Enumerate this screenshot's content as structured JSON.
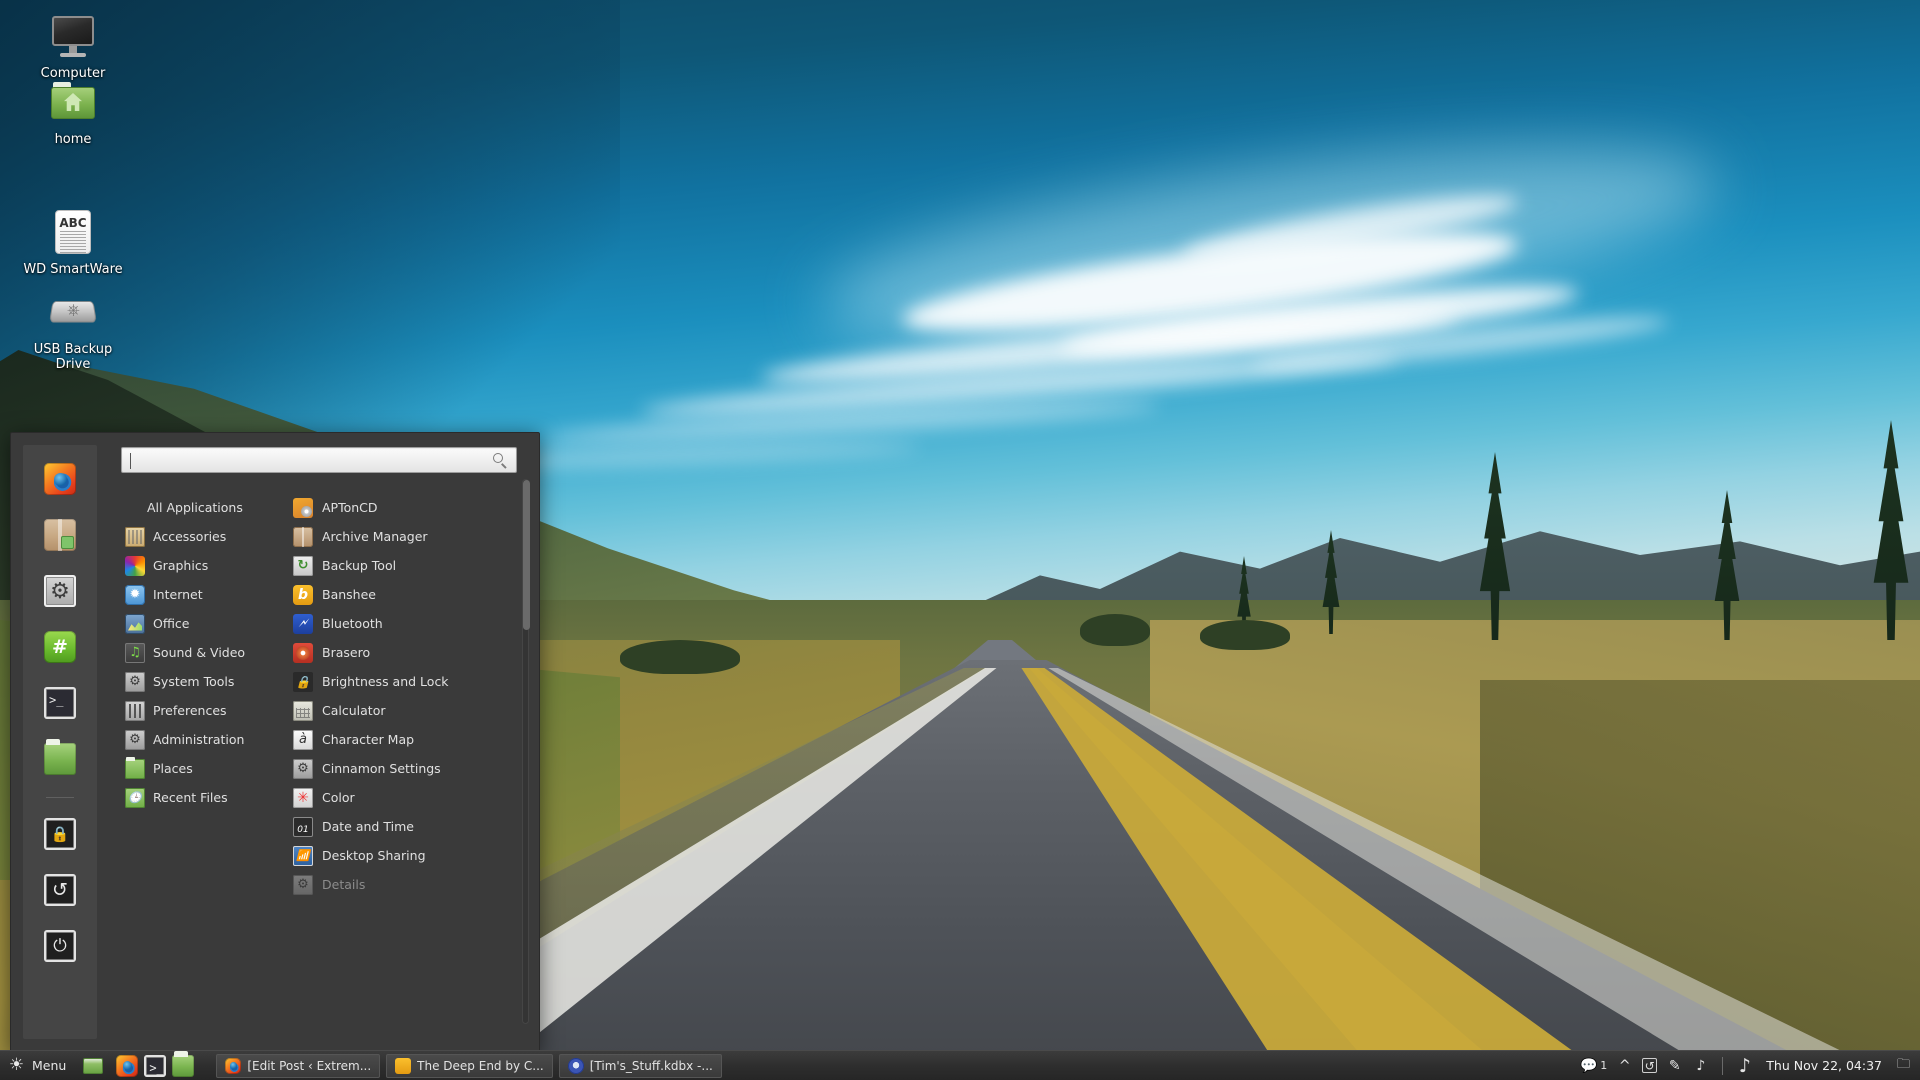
{
  "desktop": {
    "icons": [
      {
        "label": "Computer",
        "icon": "computer-monitor-icon"
      },
      {
        "label": "home",
        "icon": "home-folder-icon"
      },
      {
        "label": "WD SmartWare",
        "icon": "document-abc-icon"
      },
      {
        "label": "USB Backup Drive",
        "icon": "usb-drive-icon"
      }
    ]
  },
  "menu": {
    "search": {
      "value": "",
      "placeholder": ""
    },
    "favorites": [
      {
        "name": "firefox-web-browser",
        "icon": "firefox-icon"
      },
      {
        "name": "software-manager",
        "icon": "package-box-icon"
      },
      {
        "name": "system-settings",
        "icon": "gears-icon"
      },
      {
        "name": "chat-irc",
        "icon": "hash-chat-icon"
      },
      {
        "name": "terminal",
        "icon": "terminal-icon"
      },
      {
        "name": "files",
        "icon": "folder-icon"
      },
      {
        "name": "lock-screen",
        "icon": "lock-icon"
      },
      {
        "name": "log-out",
        "icon": "logout-icon"
      },
      {
        "name": "quit-shutdown",
        "icon": "power-icon"
      }
    ],
    "categories": [
      {
        "label": "All Applications",
        "icon": ""
      },
      {
        "label": "Accessories",
        "icon": "accessories-icon"
      },
      {
        "label": "Graphics",
        "icon": "graphics-icon"
      },
      {
        "label": "Internet",
        "icon": "internet-icon"
      },
      {
        "label": "Office",
        "icon": "office-icon"
      },
      {
        "label": "Sound & Video",
        "icon": "sound-video-icon"
      },
      {
        "label": "System Tools",
        "icon": "system-tools-icon"
      },
      {
        "label": "Preferences",
        "icon": "preferences-icon"
      },
      {
        "label": "Administration",
        "icon": "administration-icon"
      },
      {
        "label": "Places",
        "icon": "places-folder-icon"
      },
      {
        "label": "Recent Files",
        "icon": "recent-files-icon"
      }
    ],
    "applications": [
      {
        "label": "APTonCD",
        "icon": "aptoncd-icon",
        "dim": false
      },
      {
        "label": "Archive Manager",
        "icon": "archive-manager-icon",
        "dim": false
      },
      {
        "label": "Backup Tool",
        "icon": "backup-tool-icon",
        "dim": false
      },
      {
        "label": "Banshee",
        "icon": "banshee-icon",
        "dim": false
      },
      {
        "label": "Bluetooth",
        "icon": "bluetooth-icon",
        "dim": false
      },
      {
        "label": "Brasero",
        "icon": "brasero-icon",
        "dim": false
      },
      {
        "label": "Brightness and Lock",
        "icon": "brightness-lock-icon",
        "dim": false
      },
      {
        "label": "Calculator",
        "icon": "calculator-icon",
        "dim": false
      },
      {
        "label": "Character Map",
        "icon": "character-map-icon",
        "dim": false
      },
      {
        "label": "Cinnamon Settings",
        "icon": "cinnamon-settings-icon",
        "dim": false
      },
      {
        "label": "Color",
        "icon": "color-icon",
        "dim": false
      },
      {
        "label": "Date and Time",
        "icon": "date-time-icon",
        "dim": false
      },
      {
        "label": "Desktop Sharing",
        "icon": "desktop-sharing-icon",
        "dim": false
      },
      {
        "label": "Details",
        "icon": "details-icon",
        "dim": true
      }
    ]
  },
  "panel": {
    "menu_label": "Menu",
    "quicklaunch": [
      {
        "name": "firefox",
        "icon": "firefox-icon"
      },
      {
        "name": "terminal",
        "icon": "terminal-icon"
      },
      {
        "name": "files",
        "icon": "folder-icon"
      }
    ],
    "windows": [
      {
        "title": "[Edit Post ‹ Extrem...",
        "icon": "firefox-icon"
      },
      {
        "title": "The Deep End by C...",
        "icon": "banshee-icon"
      },
      {
        "title": "[Tim's_Stuff.kdbx -...",
        "icon": "keepass-icon"
      }
    ],
    "tray": [
      {
        "name": "messages-tray-icon",
        "badge": "1"
      },
      {
        "name": "chevron-up-icon",
        "badge": ""
      },
      {
        "name": "update-manager-icon",
        "badge": ""
      },
      {
        "name": "keepass-tray-icon",
        "badge": ""
      },
      {
        "name": "sound-note-icon",
        "badge": ""
      },
      {
        "name": "banshee-note-icon",
        "badge": ""
      }
    ],
    "clock": "Thu Nov 22, 04:37",
    "workspace_switcher": "workspace-switcher-icon"
  },
  "colors": {
    "panel_bg": "#2e2e2e",
    "menu_bg": "#3a3a3a",
    "favorites_bg": "#454545",
    "menu_text": "#e0e0e0",
    "menu_text_dim": "#8c8c8c",
    "scroll_thumb": "#6a6a6a"
  }
}
